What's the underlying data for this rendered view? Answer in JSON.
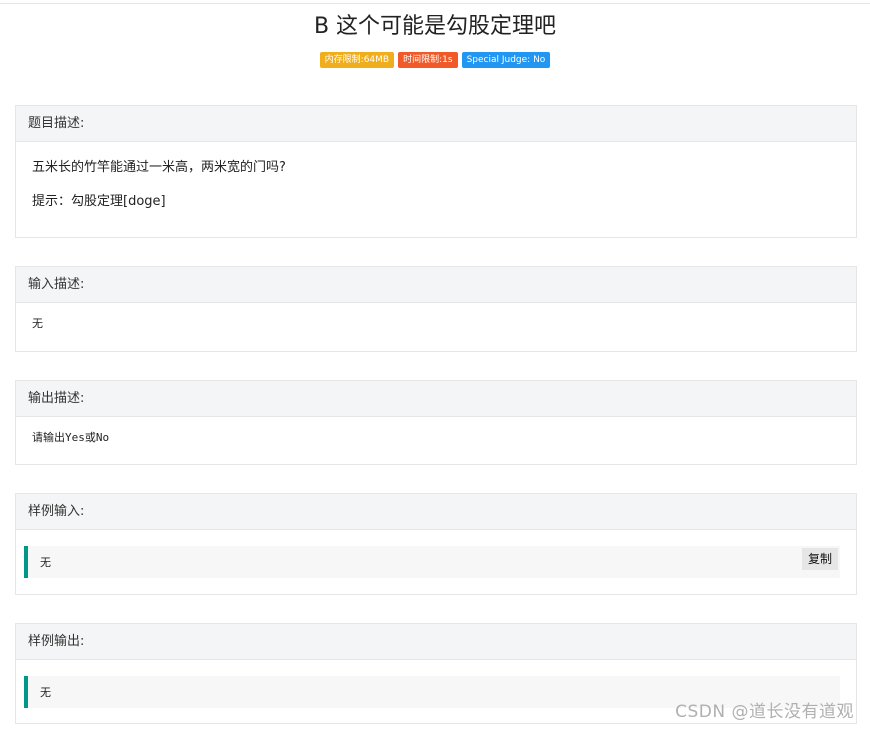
{
  "problem": {
    "title": "B 这个可能是勾股定理吧",
    "badges": {
      "memory": "内存限制:64MB",
      "time": "时间限制:1s",
      "judge": "Special Judge: No"
    }
  },
  "sections": {
    "description": {
      "heading": "题目描述:",
      "line1": "五米长的竹竿能通过一米高，两米宽的门吗?",
      "line2": "提示：勾股定理[doge]"
    },
    "input": {
      "heading": "输入描述:",
      "text": "无"
    },
    "output": {
      "heading": "输出描述:",
      "text": "请输出Yes或No"
    },
    "sample_input": {
      "heading": "样例输入:",
      "text": "无",
      "copy_label": "复制"
    },
    "sample_output": {
      "heading": "样例输出:",
      "text": "无"
    }
  },
  "watermark": "CSDN @道长没有道观",
  "colors": {
    "memory_badge": "#f0ad1c",
    "time_badge": "#f05a28",
    "judge_badge": "#2196f3",
    "sample_accent": "#009688"
  }
}
